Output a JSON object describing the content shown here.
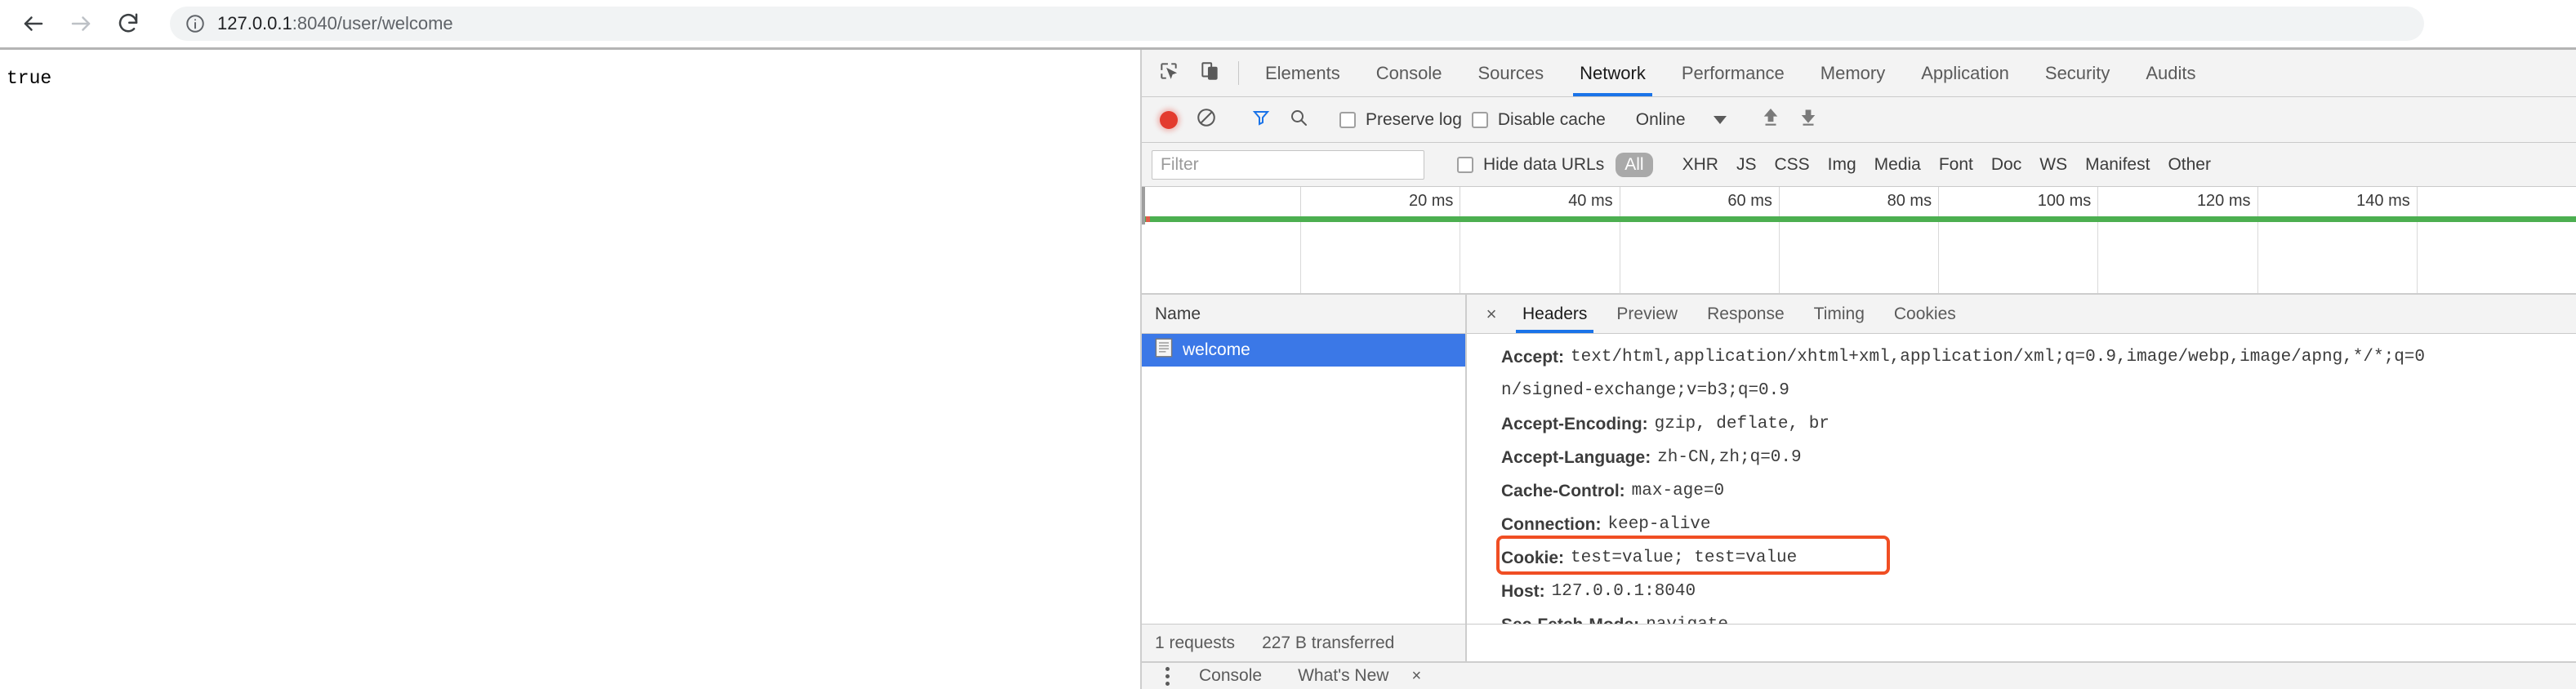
{
  "browser": {
    "back_icon": "arrow-left-icon",
    "forward_icon": "arrow-right-icon",
    "reload_icon": "reload-icon",
    "info_icon": "info-circle-icon",
    "url_host": "127.0.0.1",
    "url_rest": ":8040/user/welcome"
  },
  "page": {
    "body_text": "true"
  },
  "devtools": {
    "tools": {
      "inspect_icon": "inspect-element-icon",
      "device_icon": "device-toolbar-icon"
    },
    "tabs": [
      {
        "label": "Elements",
        "active": false
      },
      {
        "label": "Console",
        "active": false
      },
      {
        "label": "Sources",
        "active": false
      },
      {
        "label": "Network",
        "active": true
      },
      {
        "label": "Performance",
        "active": false
      },
      {
        "label": "Memory",
        "active": false
      },
      {
        "label": "Application",
        "active": false
      },
      {
        "label": "Security",
        "active": false
      },
      {
        "label": "Audits",
        "active": false
      }
    ],
    "network_toolbar": {
      "record_icon": "record-stop-icon",
      "clear_icon": "clear-icon",
      "filter_icon": "funnel-filter-icon",
      "search_icon": "search-icon",
      "preserve_log_label": "Preserve log",
      "preserve_log_checked": false,
      "disable_cache_label": "Disable cache",
      "disable_cache_checked": false,
      "throttle_value": "Online",
      "caret_icon": "chevron-down-icon",
      "import_icon": "upload-arrow-icon",
      "export_icon": "download-arrow-icon",
      "accent_color": "#1a73e8",
      "record_color": "#e33b2e",
      "filter_icon_color": "#1a73e8"
    },
    "filter_bar": {
      "filter_placeholder": "Filter",
      "filter_value": "",
      "hide_data_urls_label": "Hide data URLs",
      "hide_data_urls_checked": false,
      "types": [
        {
          "label": "All",
          "active": true
        },
        {
          "label": "XHR",
          "active": false
        },
        {
          "label": "JS",
          "active": false
        },
        {
          "label": "CSS",
          "active": false
        },
        {
          "label": "Img",
          "active": false
        },
        {
          "label": "Media",
          "active": false
        },
        {
          "label": "Font",
          "active": false
        },
        {
          "label": "Doc",
          "active": false
        },
        {
          "label": "WS",
          "active": false
        },
        {
          "label": "Manifest",
          "active": false
        },
        {
          "label": "Other",
          "active": false
        }
      ]
    },
    "timeline": {
      "ticks": [
        "",
        "20 ms",
        "40 ms",
        "60 ms",
        "80 ms",
        "100 ms",
        "120 ms",
        "140 ms",
        ""
      ],
      "green_bar_color": "#4caf50"
    },
    "requests": {
      "column_header": "Name",
      "rows": [
        {
          "name": "welcome",
          "icon": "document-icon",
          "selected": true
        }
      ]
    },
    "detail": {
      "close_icon": "close-icon",
      "tabs": [
        {
          "label": "Headers",
          "active": true
        },
        {
          "label": "Preview",
          "active": false
        },
        {
          "label": "Response",
          "active": false
        },
        {
          "label": "Timing",
          "active": false
        },
        {
          "label": "Cookies",
          "active": false
        }
      ],
      "headers": [
        {
          "name": "Accept:",
          "value": "text/html,application/xhtml+xml,application/xml;q=0.9,image/webp,image/apng,*/*;q=0",
          "continuation": false
        },
        {
          "name": "",
          "value": "n/signed-exchange;v=b3;q=0.9",
          "continuation": true
        },
        {
          "name": "Accept-Encoding:",
          "value": "gzip, deflate, br",
          "continuation": false
        },
        {
          "name": "Accept-Language:",
          "value": "zh-CN,zh;q=0.9",
          "continuation": false
        },
        {
          "name": "Cache-Control:",
          "value": "max-age=0",
          "continuation": false
        },
        {
          "name": "Connection:",
          "value": "keep-alive",
          "continuation": false
        },
        {
          "name": "Cookie:",
          "value": "test=value; test=value",
          "continuation": false
        },
        {
          "name": "Host:",
          "value": "127.0.0.1:8040",
          "continuation": false
        },
        {
          "name": "Sec-Fetch-Mode:",
          "value": "navigate",
          "continuation": false
        }
      ],
      "annotation": {
        "target": "Cookie",
        "border_color": "#f04e23"
      }
    },
    "status_bar": {
      "requests_count": "1 requests",
      "transferred": "227 B transferred"
    },
    "drawer": {
      "menu_icon": "kebab-menu-icon",
      "tabs": [
        {
          "label": "Console"
        },
        {
          "label": "What's New"
        }
      ],
      "close_icon": "close-icon"
    }
  }
}
